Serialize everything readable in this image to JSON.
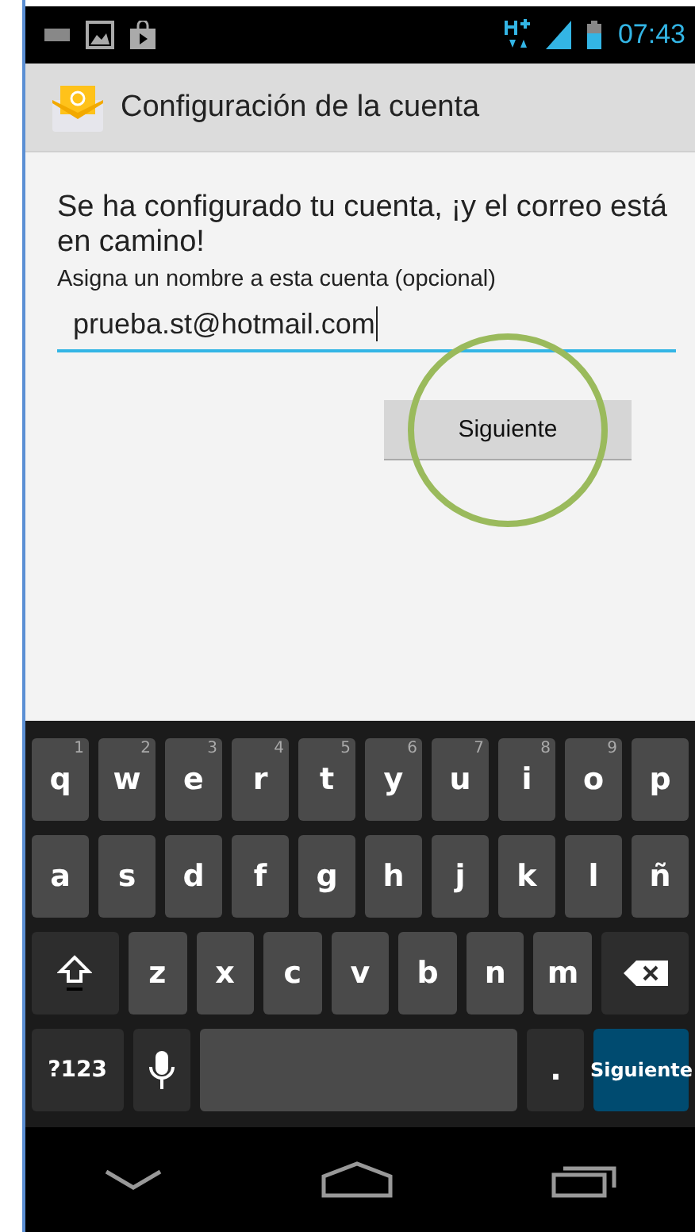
{
  "status_bar": {
    "time": "07:43"
  },
  "action_bar": {
    "title": "Configuración de la cuenta"
  },
  "content": {
    "message": "Se ha configurado tu cuenta, ¡y el correo está en camino!",
    "field_label": "Asigna un nombre a esta cuenta (opcional)",
    "field_value": "prueba.st@hotmail.com",
    "next_button": "Siguiente",
    "highlighted": true
  },
  "keyboard": {
    "rows": [
      [
        {
          "kind": "letter",
          "label": "q",
          "hint": "1"
        },
        {
          "kind": "letter",
          "label": "w",
          "hint": "2"
        },
        {
          "kind": "letter",
          "label": "e",
          "hint": "3"
        },
        {
          "kind": "letter",
          "label": "r",
          "hint": "4"
        },
        {
          "kind": "letter",
          "label": "t",
          "hint": "5"
        },
        {
          "kind": "letter",
          "label": "y",
          "hint": "6"
        },
        {
          "kind": "letter",
          "label": "u",
          "hint": "7"
        },
        {
          "kind": "letter",
          "label": "i",
          "hint": "8"
        },
        {
          "kind": "letter",
          "label": "o",
          "hint": "9"
        },
        {
          "kind": "letter",
          "label": "p"
        }
      ],
      [
        {
          "kind": "letter",
          "label": "a"
        },
        {
          "kind": "letter",
          "label": "s"
        },
        {
          "kind": "letter",
          "label": "d"
        },
        {
          "kind": "letter",
          "label": "f"
        },
        {
          "kind": "letter",
          "label": "g"
        },
        {
          "kind": "letter",
          "label": "h"
        },
        {
          "kind": "letter",
          "label": "j"
        },
        {
          "kind": "letter",
          "label": "k"
        },
        {
          "kind": "letter",
          "label": "l"
        },
        {
          "kind": "letter",
          "label": "ñ"
        }
      ],
      [
        {
          "kind": "shift"
        },
        {
          "kind": "letter",
          "label": "z"
        },
        {
          "kind": "letter",
          "label": "x"
        },
        {
          "kind": "letter",
          "label": "c"
        },
        {
          "kind": "letter",
          "label": "v"
        },
        {
          "kind": "letter",
          "label": "b"
        },
        {
          "kind": "letter",
          "label": "n"
        },
        {
          "kind": "letter",
          "label": "m"
        },
        {
          "kind": "backspace"
        }
      ]
    ],
    "bottom_row": {
      "symbols_key": "?123",
      "period_key": ".",
      "action_key": "Siguiente"
    }
  }
}
